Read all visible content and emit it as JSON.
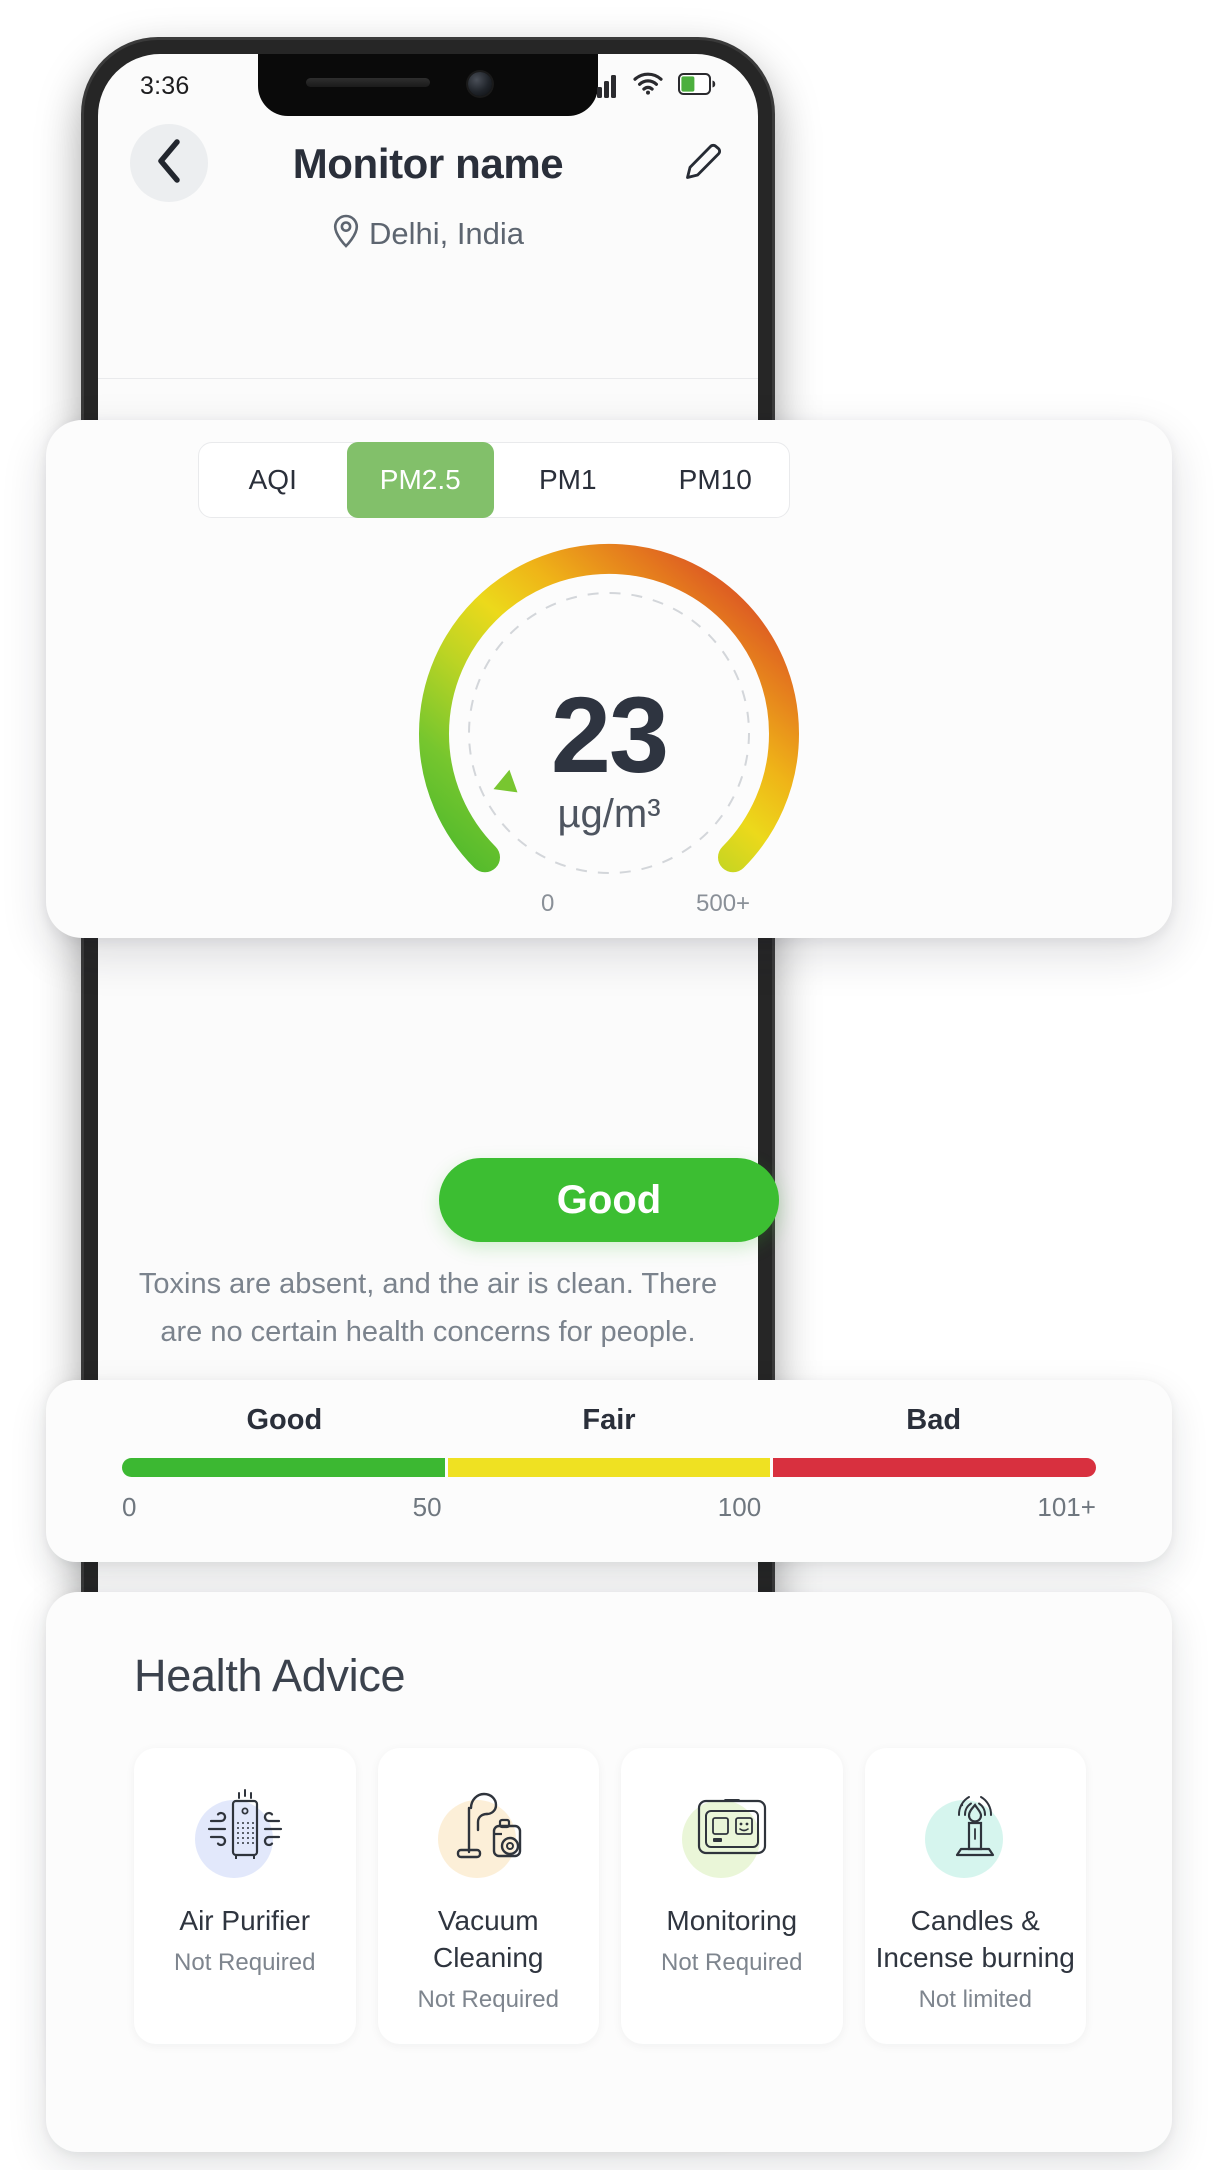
{
  "status_bar": {
    "time": "3:36",
    "signal_icon": "signal-bars-icon",
    "wifi_icon": "wifi-icon",
    "battery_icon": "battery-icon",
    "battery_color": "#4CAF3E"
  },
  "header": {
    "back_icon": "chevron-left-icon",
    "title": "Monitor name",
    "location_icon": "map-pin-icon",
    "location": "Delhi, India",
    "edit_icon": "pencil-icon"
  },
  "tabs": [
    {
      "label": "AQI",
      "active": false
    },
    {
      "label": "PM2.5",
      "active": true
    },
    {
      "label": "PM1",
      "active": false
    },
    {
      "label": "PM10",
      "active": false
    }
  ],
  "tab_active_color": "#82c06a",
  "gauge": {
    "value": "23",
    "unit": "µg/m³",
    "min_label": "0",
    "max_label": "500+",
    "pointer_icon": "gauge-pointer-triangle",
    "pointer_color": "#78C630",
    "gradient_stops": [
      "#5BBE2E",
      "#8FC92B",
      "#E8DE1C",
      "#F0B418",
      "#E2701F",
      "#D32F2F"
    ]
  },
  "status_button": {
    "label": "Good",
    "color": "#3cbe32"
  },
  "description": {
    "line1": "Toxins are absent, and the air is clean. There",
    "line2": "are no certain health concerns for people."
  },
  "scale": {
    "labels": [
      "Good",
      "Fair",
      "Bad"
    ],
    "segment_colors": [
      "#3cb832",
      "#efe122",
      "#d8303f"
    ],
    "ticks": [
      "0",
      "50",
      "100",
      "101+"
    ]
  },
  "health_advice": {
    "title": "Health Advice",
    "items": [
      {
        "label": "Air Purifier",
        "status": "Not Required",
        "icon": "air-purifier-icon",
        "blob_color": "#e2e8fb"
      },
      {
        "label": "Vacuum Cleaning",
        "status": "Not Required",
        "icon": "vacuum-cleaner-icon",
        "blob_color": "#fcefd8"
      },
      {
        "label": "Monitoring",
        "status": "Not Required",
        "icon": "air-monitor-icon",
        "blob_color": "#eaf6d8"
      },
      {
        "label": "Candles & Incense burning",
        "status": "Not limited",
        "icon": "candle-icon",
        "blob_color": "#d6f5ee"
      }
    ]
  }
}
